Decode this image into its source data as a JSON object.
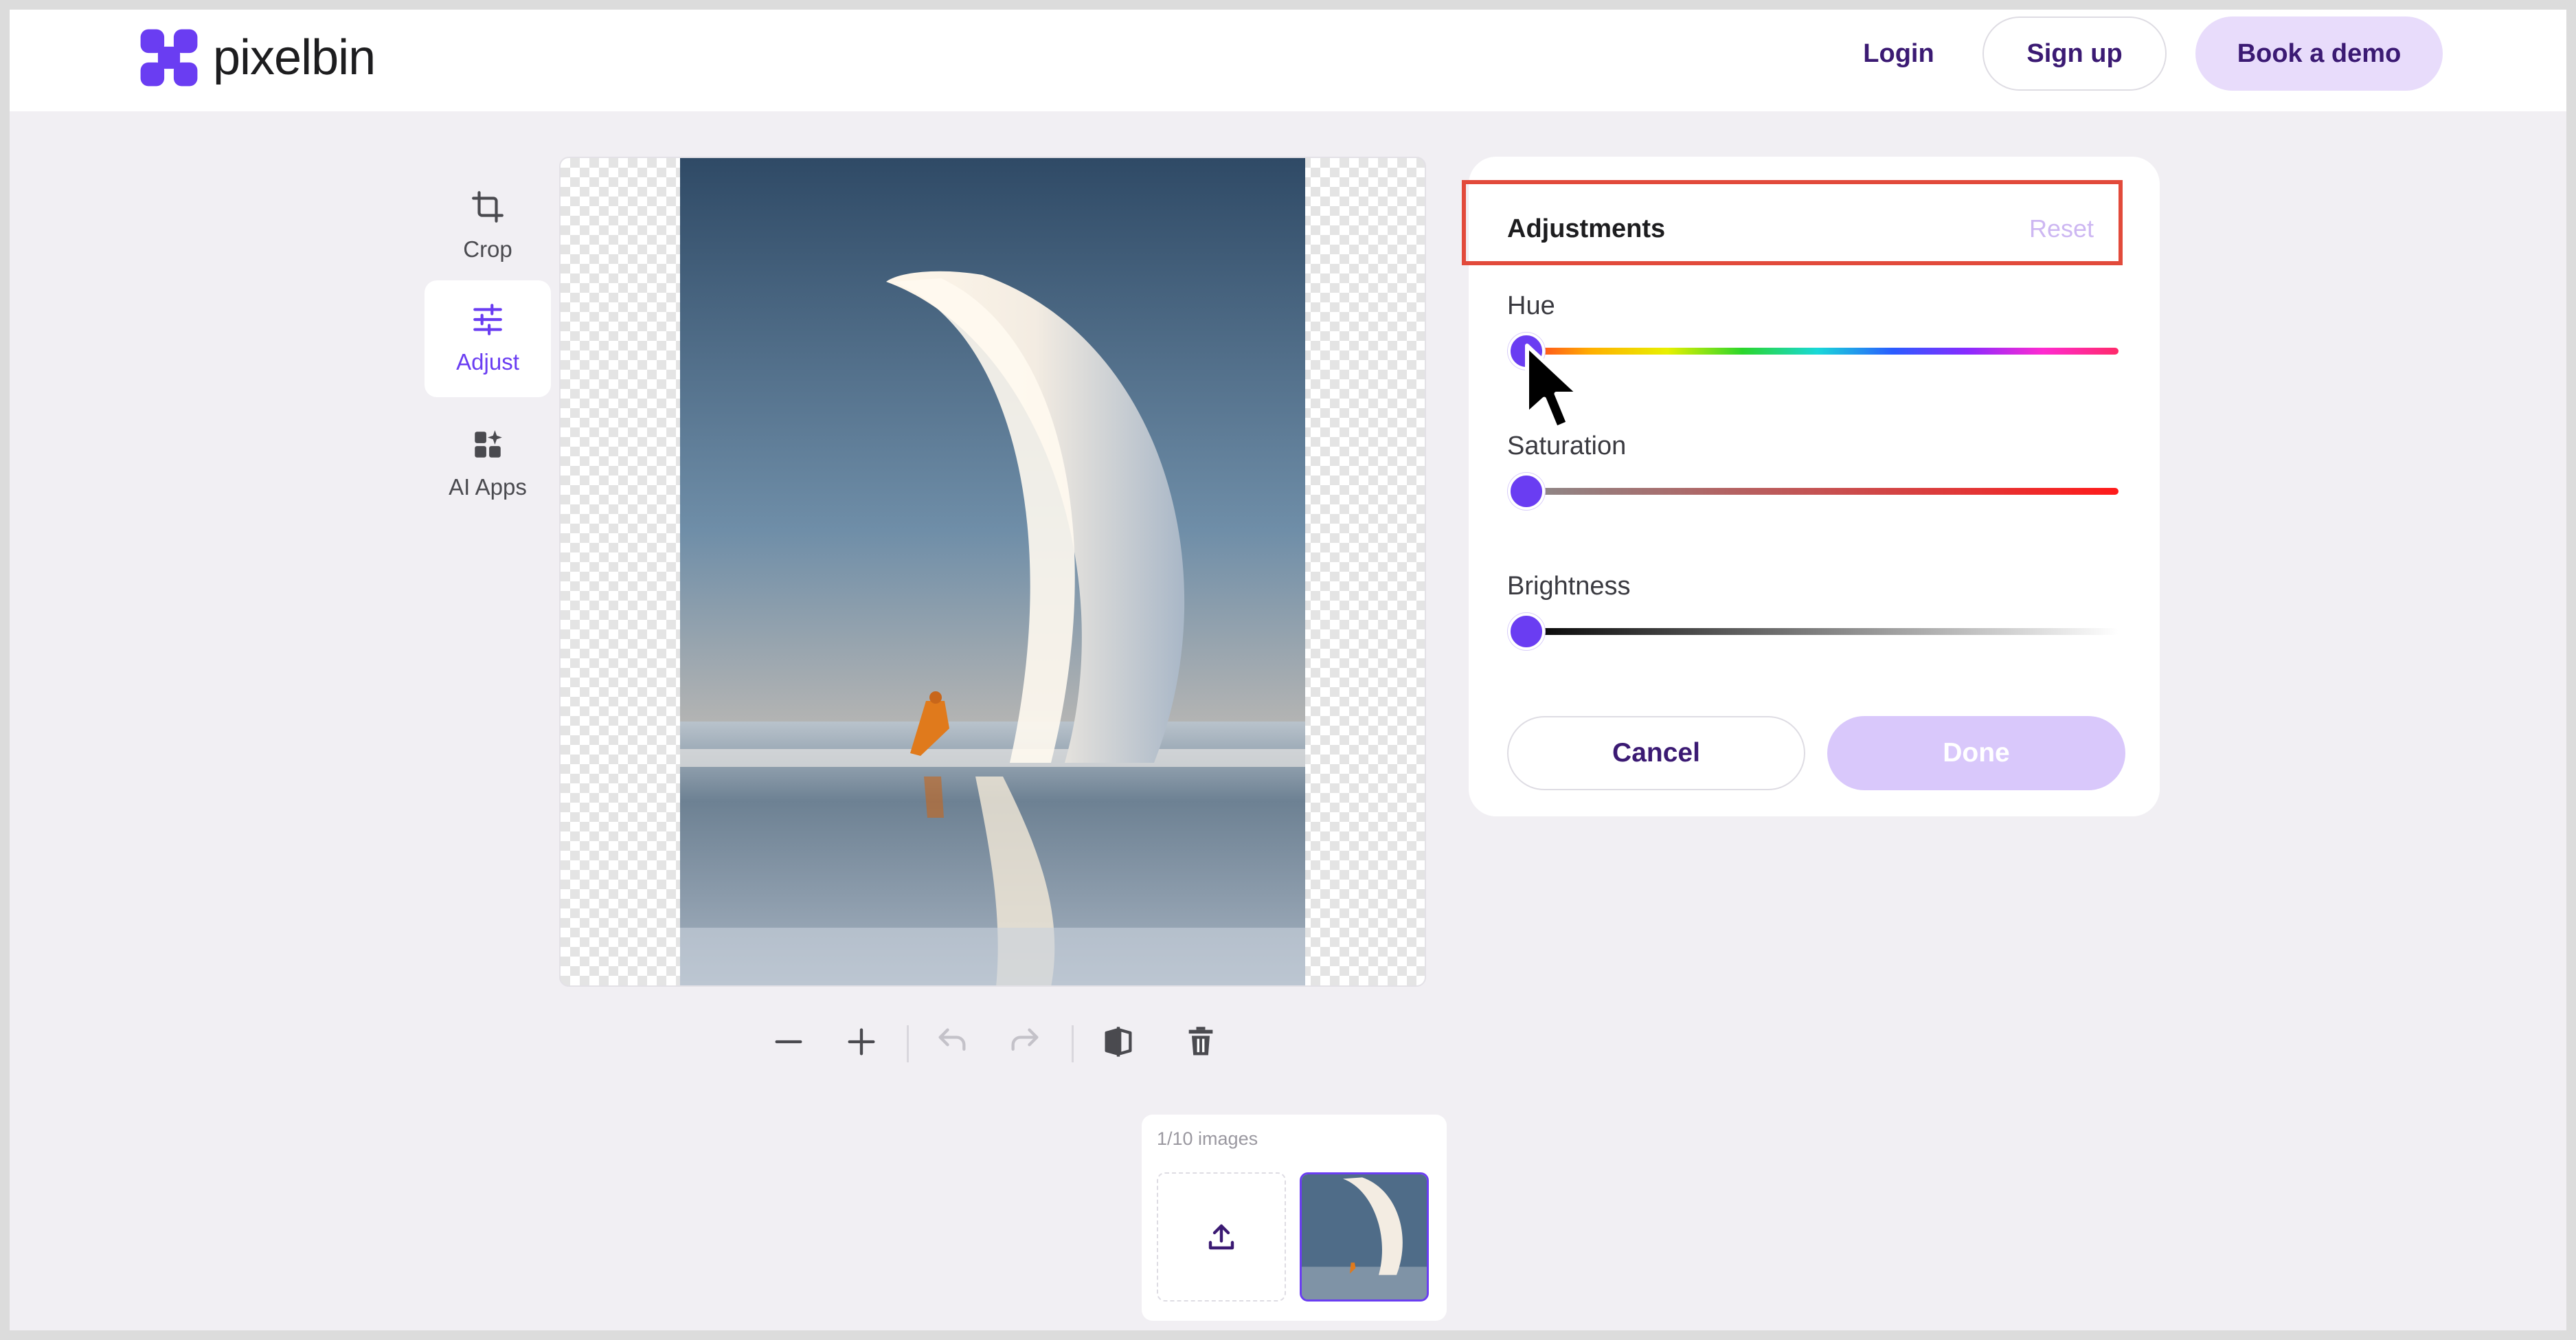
{
  "header": {
    "brand": "pixelbin",
    "login_label": "Login",
    "signup_label": "Sign up",
    "demo_label": "Book a demo"
  },
  "tools": [
    {
      "label": "Crop",
      "icon": "crop-icon"
    },
    {
      "label": "Adjust",
      "icon": "sliders-icon",
      "active": true
    },
    {
      "label": "AI Apps",
      "icon": "apps-icon"
    }
  ],
  "toolbar": {
    "icons": [
      "zoom-out-icon",
      "zoom-in-icon",
      "undo-icon",
      "redo-icon",
      "compare-icon",
      "delete-icon"
    ]
  },
  "strip": {
    "count": "1/10 images",
    "icons": [
      "upload-icon"
    ]
  },
  "panel": {
    "title": "Adjustments",
    "reset_label": "Reset",
    "sliders": [
      {
        "label": "Hue",
        "value": 0
      },
      {
        "label": "Saturation",
        "value": 0
      },
      {
        "label": "Brightness",
        "value": 0
      }
    ],
    "cancel_label": "Cancel",
    "done_label": "Done"
  },
  "colors": {
    "accent": "#6a3df2",
    "brand_dark": "#3b1a73",
    "done_disabled": "#d9c8fb",
    "highlight": "#e24a3b"
  }
}
